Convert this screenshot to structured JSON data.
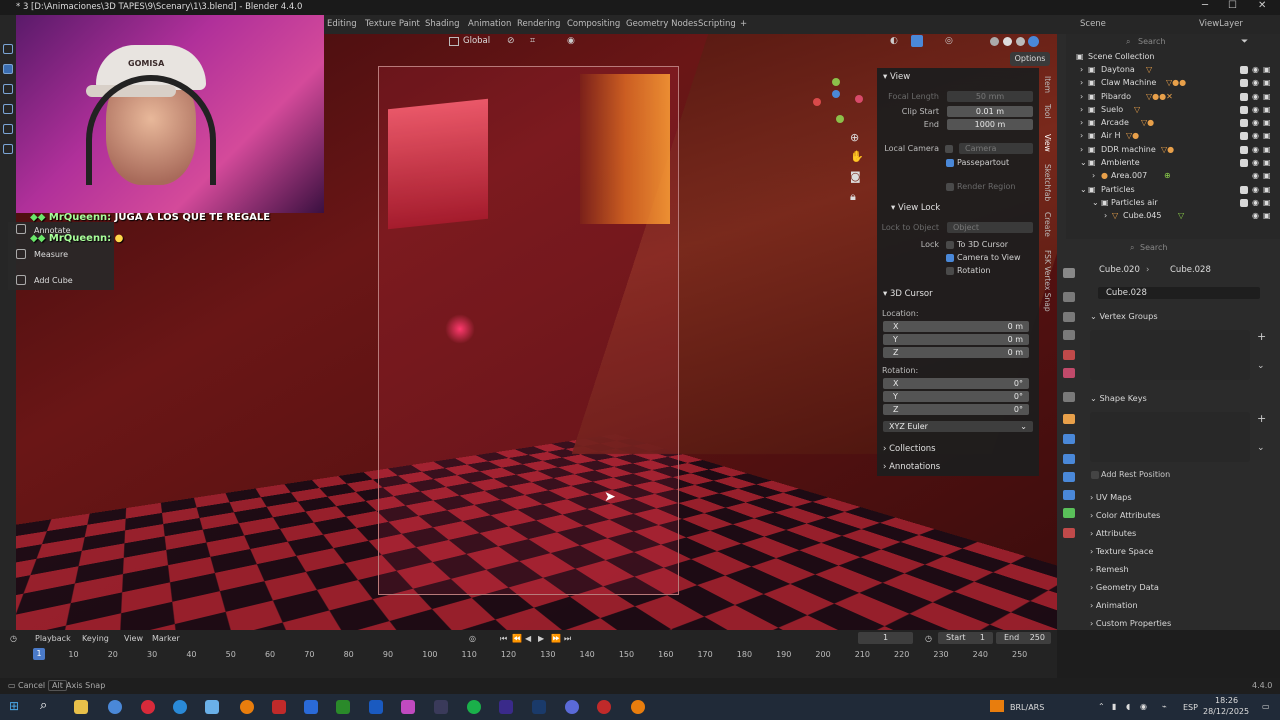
{
  "window": {
    "title": "* 3 [D:\\Animaciones\\3D TAPES\\9\\Scenary\\1\\3.blend] - Blender 4.4.0",
    "min": "─",
    "max": "☐",
    "close": "✕"
  },
  "workspaces": [
    "Editing",
    "Texture Paint",
    "Shading",
    "Animation",
    "Rendering",
    "Compositing",
    "Geometry Nodes",
    "Scripting",
    "+"
  ],
  "scene_selector": {
    "scene": "Scene",
    "view_layer": "ViewLayer"
  },
  "viewport_header": {
    "orientation": "Global",
    "options": "Options"
  },
  "chat": [
    {
      "user": "MrQueenn:",
      "message": "JUGA A LOS QUE TE REGALE"
    },
    {
      "user": "MrQueenn:",
      "message": ""
    }
  ],
  "webcam": {
    "cap_text": "GOMISA"
  },
  "tool_menu": [
    "Annotate",
    "Measure",
    "Add Cube"
  ],
  "npanel": {
    "view_title": "View",
    "focal_length_label": "Focal Length",
    "focal_length": "50 mm",
    "clip_start_label": "Clip Start",
    "clip_start": "0.01 m",
    "end_label": "End",
    "end": "1000 m",
    "local_camera_label": "Local Camera",
    "local_camera": "Camera",
    "passepartout": "Passepartout",
    "render_region": "Render Region",
    "view_lock_title": "View Lock",
    "lock_to_object_label": "Lock to Object",
    "lock_to_object": "Object",
    "lock_label": "Lock",
    "to_3d_cursor": "To 3D Cursor",
    "camera_to_view": "Camera to View",
    "rotation_lock": "Rotation",
    "cursor_title": "3D Cursor",
    "location_label": "Location:",
    "loc": [
      {
        "axis": "X",
        "value": "0 m"
      },
      {
        "axis": "Y",
        "value": "0 m"
      },
      {
        "axis": "Z",
        "value": "0 m"
      }
    ],
    "rotation_label": "Rotation:",
    "rot": [
      {
        "axis": "X",
        "value": "0°"
      },
      {
        "axis": "Y",
        "value": "0°"
      },
      {
        "axis": "Z",
        "value": "0°"
      }
    ],
    "rotation_mode": "XYZ Euler",
    "collections": "Collections",
    "annotations": "Annotations",
    "tabs": [
      "Item",
      "Tool",
      "View",
      "Sketchfab",
      "Create",
      "FSK Vertex Snap"
    ]
  },
  "outliner": {
    "search_placeholder": "Search",
    "root": "Scene Collection",
    "items": [
      "Daytona",
      "Claw Machine",
      "Pibardo",
      "Suelo",
      "Arcade",
      "Air H",
      "DDR machine",
      "Ambiente",
      "Area.007",
      "Particles",
      "Particles air",
      "Cube.045"
    ]
  },
  "properties": {
    "search_placeholder": "Search",
    "breadcrumb_obj": "Cube.020",
    "breadcrumb_mesh": "Cube.028",
    "datablock": "Cube.028",
    "sections": [
      "Vertex Groups",
      "Shape Keys"
    ],
    "add_rest_position": "Add Rest Position",
    "collapsed": [
      "UV Maps",
      "Color Attributes",
      "Attributes",
      "Texture Space",
      "Remesh",
      "Geometry Data",
      "Animation",
      "Custom Properties"
    ]
  },
  "timeline": {
    "menus": [
      "Playback",
      "Keying",
      "View",
      "Marker"
    ],
    "current_frame": "1",
    "start_label": "Start",
    "start": "1",
    "end_label": "End",
    "end": "250",
    "frames": [
      "1",
      "10",
      "20",
      "30",
      "40",
      "50",
      "60",
      "70",
      "80",
      "90",
      "100",
      "110",
      "120",
      "130",
      "140",
      "150",
      "160",
      "170",
      "180",
      "190",
      "200",
      "210",
      "220",
      "230",
      "240",
      "250"
    ]
  },
  "statusbar": {
    "cancel": "Cancel",
    "alt": "Alt",
    "axis_snap": "Axis Snap",
    "version": "4.4.0"
  },
  "taskbar": {
    "currency": "BRL/ARS",
    "lang": "ESP",
    "time": "18:26",
    "date": "28/12/2025"
  },
  "colors": {
    "accent": "#4a88d8",
    "brand_orange": "#e87d0d"
  }
}
